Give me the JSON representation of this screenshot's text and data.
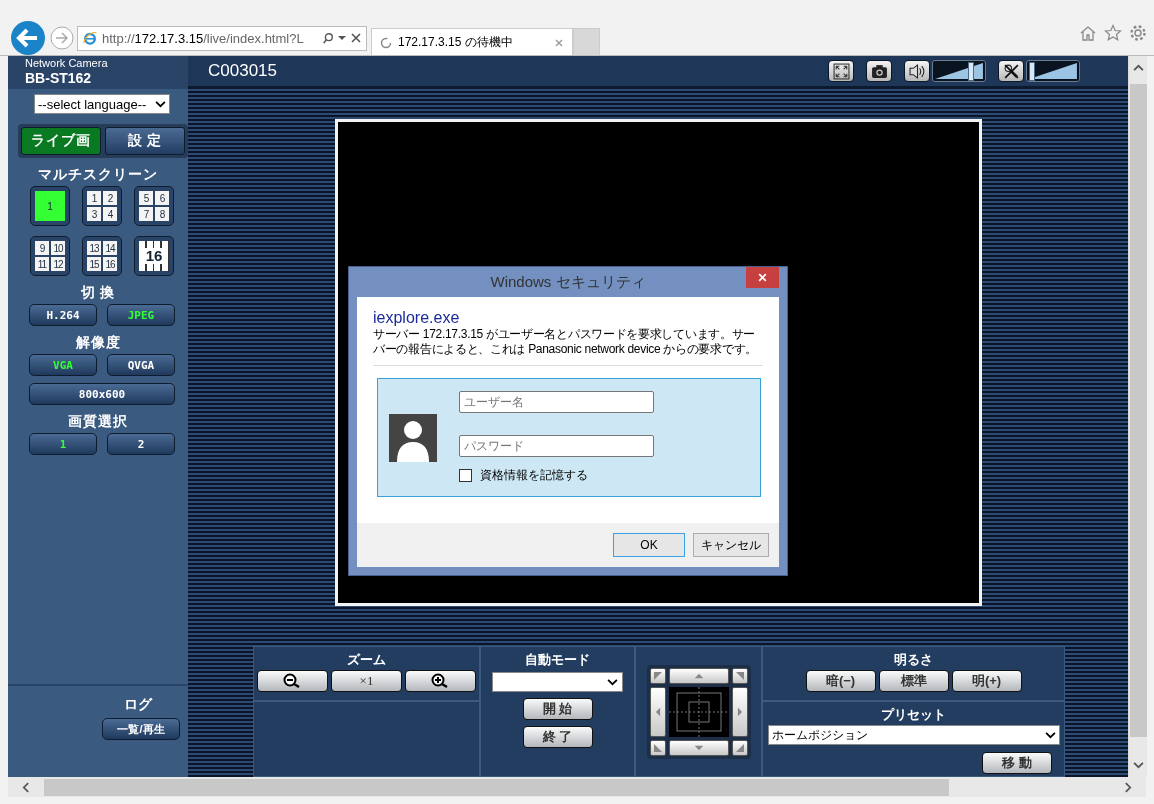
{
  "browser": {
    "address": {
      "scheme": "http://",
      "host": "172.17.3.15",
      "path": "/live/index.html?L"
    },
    "tab": {
      "title": "172.17.3.15 の待機中"
    }
  },
  "header": {
    "brand": "Network Camera",
    "model": "BB-ST162",
    "camera_title": "C003015",
    "volume": {
      "level": 0.72
    },
    "mic": {
      "level": 0.04
    }
  },
  "sidebar": {
    "language_select": "--select language--",
    "mode_tabs": [
      {
        "label": "ライブ画",
        "selected": true
      },
      {
        "label": "設 定",
        "selected": false
      }
    ],
    "multiscreen": {
      "title": "マルチスクリーン",
      "options": [
        {
          "kind": "single",
          "numbers": [
            "1"
          ],
          "selected": true
        },
        {
          "kind": "quad",
          "numbers": [
            "1",
            "2",
            "3",
            "4"
          ],
          "selected": false
        },
        {
          "kind": "quad",
          "numbers": [
            "5",
            "6",
            "7",
            "8"
          ],
          "selected": false
        },
        {
          "kind": "quad",
          "numbers": [
            "9",
            "10",
            "11",
            "12"
          ],
          "selected": false
        },
        {
          "kind": "quad",
          "numbers": [
            "13",
            "14",
            "15",
            "16"
          ],
          "selected": false
        },
        {
          "kind": "grid16",
          "numbers": [
            "16"
          ],
          "selected": false
        }
      ]
    },
    "switch": {
      "title": "切 換",
      "options": [
        {
          "label": "H.264",
          "selected": false
        },
        {
          "label": "JPEG",
          "selected": true
        }
      ]
    },
    "resolution": {
      "title": "解像度",
      "options": [
        {
          "label": "VGA",
          "selected": true
        },
        {
          "label": "QVGA",
          "selected": false
        },
        {
          "label": "800x600",
          "selected": false
        }
      ]
    },
    "quality": {
      "title": "画質選択",
      "options": [
        {
          "label": "1",
          "selected": true
        },
        {
          "label": "2",
          "selected": false
        }
      ]
    },
    "log": {
      "title": "ログ",
      "button": "一覧/再生"
    }
  },
  "dialog": {
    "title": "Windows セキュリティ",
    "app": "iexplore.exe",
    "message": "サーバー 172.17.3.15 がユーザー名とパスワードを要求しています。サーバーの報告によると、これは Panasonic network device からの要求です。",
    "username_placeholder": "ユーザー名",
    "password_placeholder": "パスワード",
    "remember": {
      "label": "資格情報を記憶する",
      "checked": false
    },
    "buttons": [
      "OK",
      "キャンセル"
    ]
  },
  "controls": {
    "zoom": {
      "title": "ズーム",
      "reset": "×1"
    },
    "auto_mode": {
      "title": "自動モード",
      "buttons": [
        "開 始",
        "終 了"
      ]
    },
    "brightness": {
      "title": "明るさ",
      "buttons": [
        "暗(−)",
        "標準",
        "明(+)"
      ]
    },
    "preset": {
      "title": "プリセット",
      "value": "ホームポジション",
      "button": "移 動"
    }
  }
}
